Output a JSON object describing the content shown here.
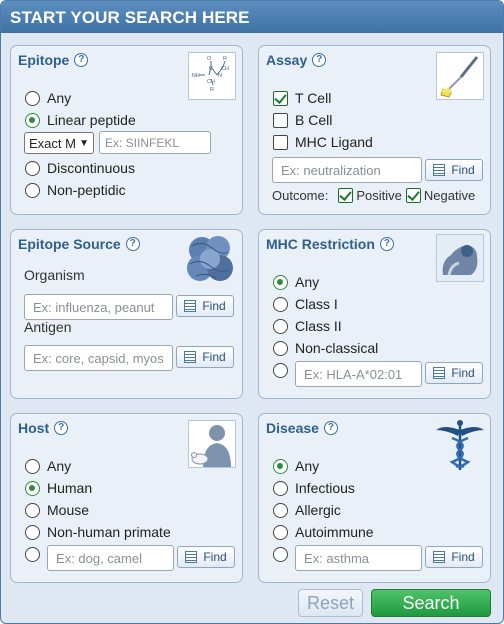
{
  "header": {
    "title": "START YOUR SEARCH HERE"
  },
  "epitope": {
    "title": "Epitope",
    "options": [
      "Any",
      "Linear peptide",
      "Discontinuous",
      "Non-peptidic"
    ],
    "selected": "Linear peptide",
    "match_select": "Exact M",
    "sequence_placeholder": "Ex: SIINFEKL",
    "icon": "chemical-structure-icon"
  },
  "assay": {
    "title": "Assay",
    "options": [
      {
        "label": "T Cell",
        "checked": true
      },
      {
        "label": "B Cell",
        "checked": false
      },
      {
        "label": "MHC Ligand",
        "checked": false
      }
    ],
    "search_placeholder": "Ex: neutralization",
    "find_label": "Find",
    "outcome_label": "Outcome:",
    "outcome_options": [
      {
        "label": "Positive",
        "checked": true
      },
      {
        "label": "Negative",
        "checked": true
      }
    ],
    "icon": "pipette-icon"
  },
  "epitope_source": {
    "title": "Epitope Source",
    "organism_label": "Organism",
    "organism_placeholder": "Ex: influenza, peanut",
    "antigen_label": "Antigen",
    "antigen_placeholder": "Ex: core, capsid, myos",
    "find_label": "Find",
    "icon": "protein-structure-icon"
  },
  "mhc": {
    "title": "MHC Restriction",
    "options": [
      "Any",
      "Class I",
      "Class II",
      "Non-classical"
    ],
    "selected": "Any",
    "custom_placeholder": "Ex: HLA-A*02:01",
    "find_label": "Find",
    "icon": "mhc-molecule-icon"
  },
  "host": {
    "title": "Host",
    "options": [
      "Any",
      "Human",
      "Mouse",
      "Non-human primate"
    ],
    "selected": "Human",
    "custom_placeholder": "Ex: dog, camel",
    "find_label": "Find",
    "icon": "human-mouse-icon"
  },
  "disease": {
    "title": "Disease",
    "options": [
      "Any",
      "Infectious",
      "Allergic",
      "Autoimmune"
    ],
    "selected": "Any",
    "custom_placeholder": "Ex: asthma",
    "find_label": "Find",
    "icon": "caduceus-icon"
  },
  "actions": {
    "reset_label": "Reset",
    "search_label": "Search"
  },
  "colors": {
    "header": "#4a7fb3",
    "panel_bg": "#eaf0f7",
    "panel_title": "#2e5f8f",
    "search_button": "#2aa748",
    "selected_radio": "#2f8a3c"
  }
}
